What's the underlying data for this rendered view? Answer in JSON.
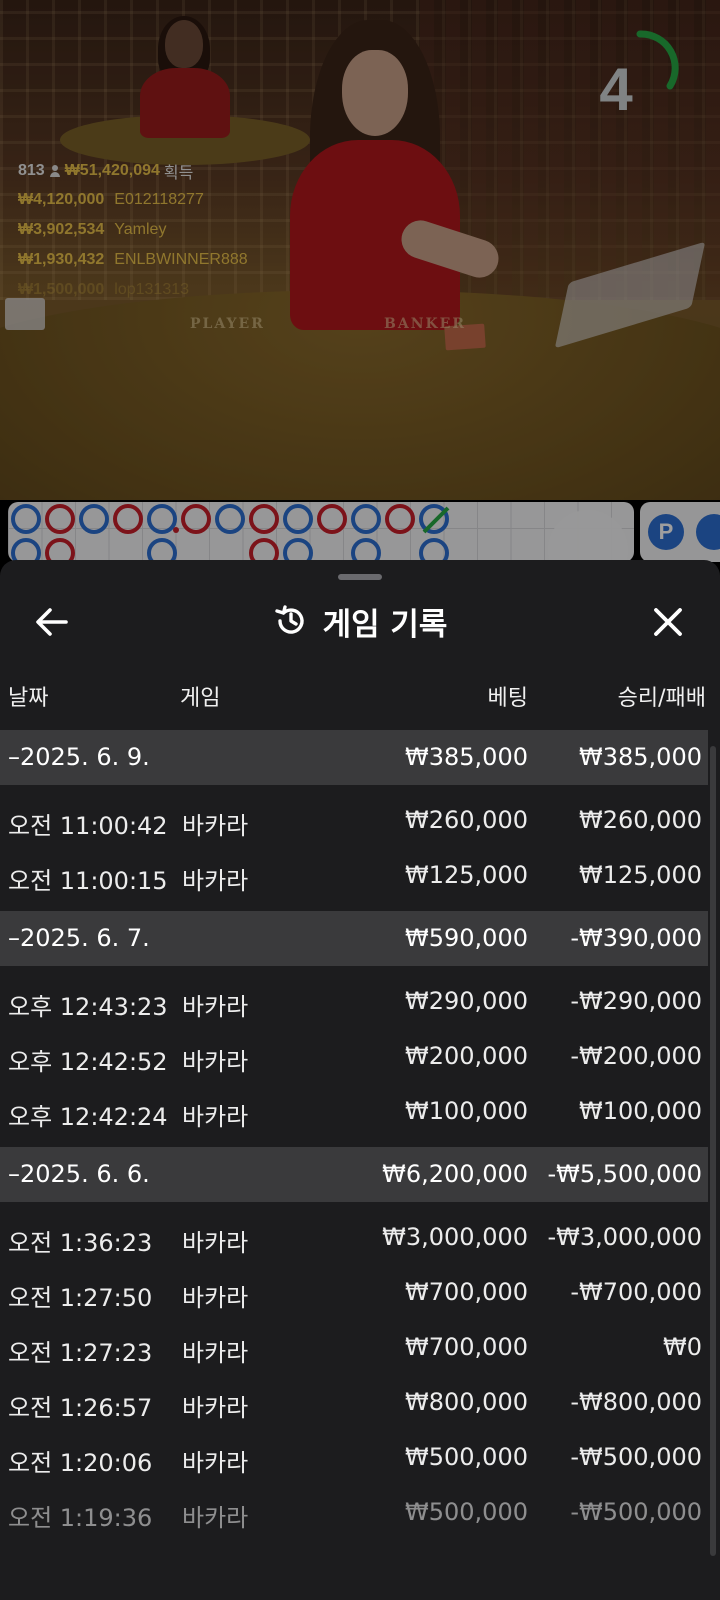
{
  "video": {
    "countdown": "4",
    "table_labels": {
      "player": "PLAYER",
      "banker": "BANKER"
    },
    "winners": {
      "count": "813",
      "total": "₩51,420,094",
      "total_label": "획득",
      "rows": [
        {
          "amount": "₩4,120,000",
          "name": "E012118277"
        },
        {
          "amount": "₩3,902,534",
          "name": "Yamley"
        },
        {
          "amount": "₩1,930,432",
          "name": "ENLBWINNER888"
        },
        {
          "amount": "₩1,500,000",
          "name": "lop131313"
        }
      ]
    },
    "colors": {
      "countdown_ring": "#27a844",
      "winner_gold": "#e8c04a"
    }
  },
  "roadmap": {
    "player_badge": "P",
    "colors": {
      "banker": "#c8202a",
      "player": "#2d6fd0",
      "tie": "#27a844"
    }
  },
  "sheet": {
    "title": "게임 기록",
    "icons": {
      "back": "arrow-left-icon",
      "history": "history-icon",
      "close": "close-icon"
    },
    "columns": {
      "date": "날짜",
      "game": "게임",
      "bet": "베팅",
      "result": "승리/패배"
    },
    "groups": [
      {
        "date": "–2025. 6. 9.",
        "bet": "₩385,000",
        "result": "₩385,000",
        "items": [
          {
            "time": "오전 11:00:42",
            "game": "바카라",
            "bet": "₩260,000",
            "result": "₩260,000"
          },
          {
            "time": "오전 11:00:15",
            "game": "바카라",
            "bet": "₩125,000",
            "result": "₩125,000"
          }
        ]
      },
      {
        "date": "–2025. 6. 7.",
        "bet": "₩590,000",
        "result": "-₩390,000",
        "items": [
          {
            "time": "오후 12:43:23",
            "game": "바카라",
            "bet": "₩290,000",
            "result": "-₩290,000"
          },
          {
            "time": "오후 12:42:52",
            "game": "바카라",
            "bet": "₩200,000",
            "result": "-₩200,000"
          },
          {
            "time": "오후 12:42:24",
            "game": "바카라",
            "bet": "₩100,000",
            "result": "₩100,000"
          }
        ]
      },
      {
        "date": "–2025. 6. 6.",
        "bet": "₩6,200,000",
        "result": "-₩5,500,000",
        "items": [
          {
            "time": "오전 1:36:23",
            "game": "바카라",
            "bet": "₩3,000,000",
            "result": "-₩3,000,000"
          },
          {
            "time": "오전 1:27:50",
            "game": "바카라",
            "bet": "₩700,000",
            "result": "-₩700,000"
          },
          {
            "time": "오전 1:27:23",
            "game": "바카라",
            "bet": "₩700,000",
            "result": "₩0"
          },
          {
            "time": "오전 1:26:57",
            "game": "바카라",
            "bet": "₩800,000",
            "result": "-₩800,000"
          },
          {
            "time": "오전 1:20:06",
            "game": "바카라",
            "bet": "₩500,000",
            "result": "-₩500,000"
          },
          {
            "time": "오전 1:19:36",
            "game": "바카라",
            "bet": "₩500,000",
            "result": "-₩500,000"
          }
        ]
      }
    ]
  }
}
